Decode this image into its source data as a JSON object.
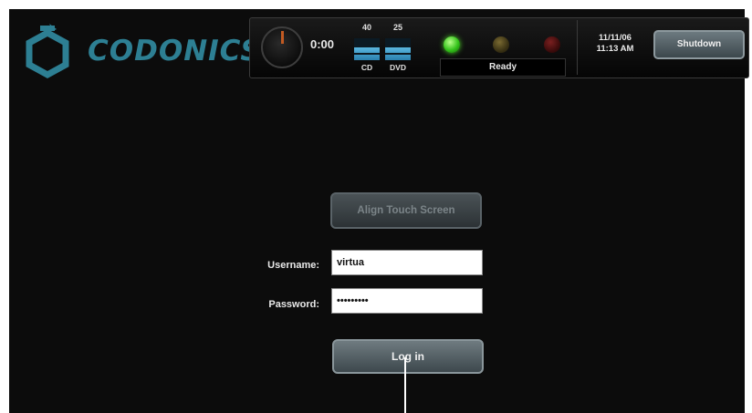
{
  "header": {
    "brand_name": "CODONICS",
    "timer": "0:00",
    "media": [
      {
        "label": "CD",
        "capacity": "40",
        "level": 0.6
      },
      {
        "label": "DVD",
        "capacity": "25",
        "level": 0.6
      }
    ],
    "status_leds": [
      {
        "name": "green",
        "state": "on",
        "color": "#33c21a"
      },
      {
        "name": "yellow",
        "state": "off",
        "color": "#3a3214"
      },
      {
        "name": "red",
        "state": "off",
        "color": "#3e0c0c"
      }
    ],
    "status_text": "Ready",
    "date": "11/11/06",
    "time": "11:13 AM",
    "shutdown_label": "Shutdown"
  },
  "login": {
    "align_touch_label": "Align Touch Screen",
    "username_label": "Username:",
    "username_value": "virtua",
    "password_label": "Password:",
    "password_value": "•••••••••",
    "login_label": "Log in"
  },
  "colors": {
    "brand": "#2d7f93",
    "background": "#0c0c0c",
    "button": "#4f5b60"
  }
}
